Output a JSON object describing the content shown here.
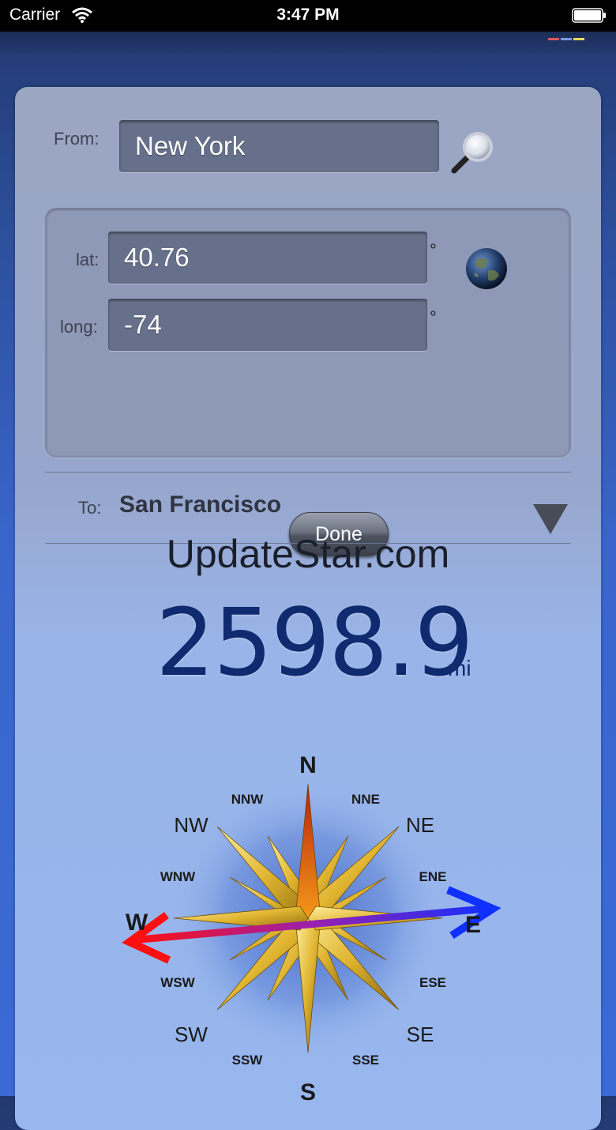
{
  "status_bar": {
    "carrier": "Carrier",
    "time": "3:47 PM"
  },
  "from": {
    "label": "From:",
    "value": "New York"
  },
  "coordinates": {
    "lat_label": "lat:",
    "lat_value": "40.76",
    "long_label": "long:",
    "long_value": "-74",
    "degree_symbol": "°",
    "done_label": "Done"
  },
  "to": {
    "label": "To:",
    "value": "San Francisco"
  },
  "watermark": "UpdateStar.com",
  "distance": {
    "value": "2598.9",
    "unit": "mi"
  },
  "compass": {
    "N": "N",
    "S": "S",
    "E": "E",
    "W": "W",
    "NE": "NE",
    "NW": "NW",
    "SE": "SE",
    "SW": "SW",
    "NNE": "NNE",
    "NNW": "NNW",
    "ENE": "ENE",
    "WNW": "WNW",
    "ESE": "ESE",
    "WSW": "WSW",
    "SSE": "SSE",
    "SSW": "SSW"
  }
}
